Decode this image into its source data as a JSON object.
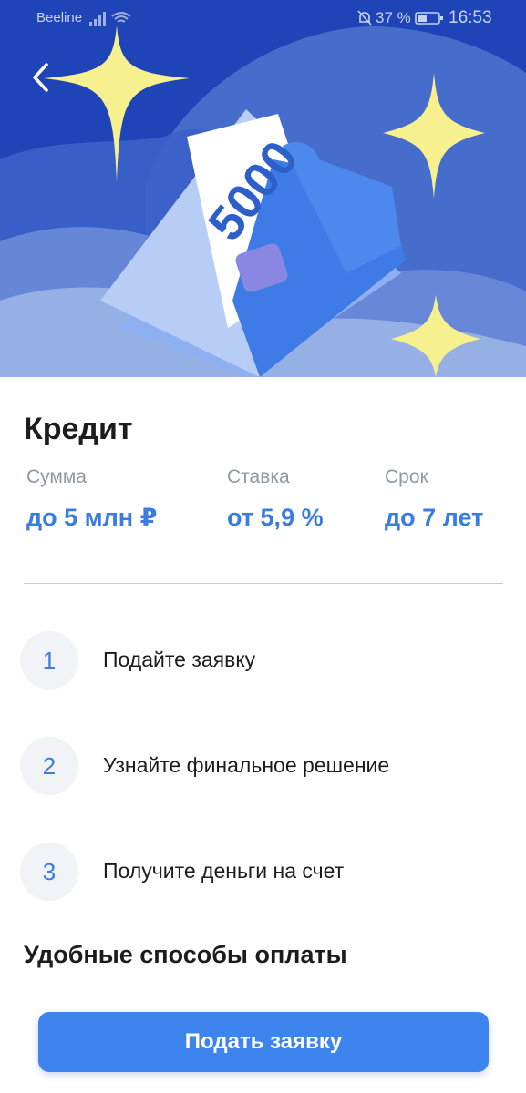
{
  "status_bar": {
    "carrier": "Beeline",
    "battery_percent": "37 %",
    "time": "16:53"
  },
  "hero": {
    "banknote_value": "5000",
    "colors": {
      "background": "#1f44b8",
      "star": "#f6f08e",
      "note_blue": "#3f7be6"
    }
  },
  "credit": {
    "title": "Кредит",
    "params": [
      {
        "label": "Сумма",
        "value": "до 5 млн ₽"
      },
      {
        "label": "Ставка",
        "value": "от 5,9 %"
      },
      {
        "label": "Срок",
        "value": "до 7 лет"
      }
    ]
  },
  "steps": [
    {
      "number": "1",
      "text": "Подайте заявку"
    },
    {
      "number": "2",
      "text": "Узнайте финальное решение"
    },
    {
      "number": "3",
      "text": "Получите деньги на счет"
    }
  ],
  "payment_section": {
    "title": "Удобные способы оплаты"
  },
  "cta": {
    "label": "Подать заявку",
    "color": "#3d84ee"
  }
}
